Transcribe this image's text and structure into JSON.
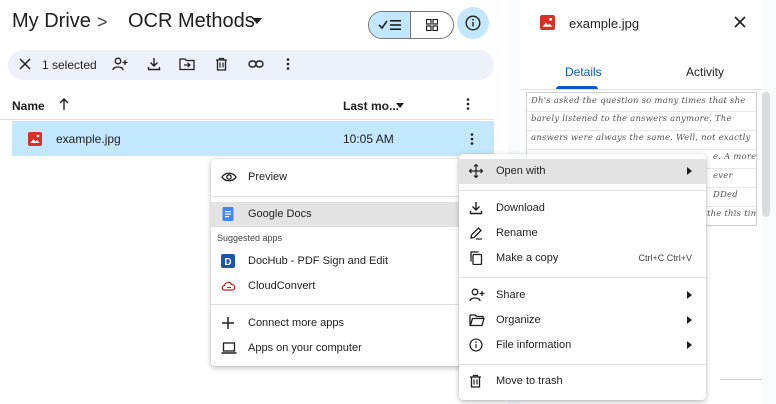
{
  "breadcrumb": {
    "root": "My Drive",
    "separator": ">",
    "folder": "OCR Methods"
  },
  "toolbar": {
    "selected_count": "1 selected"
  },
  "list": {
    "columns": {
      "name": "Name",
      "modified": "Last mo..."
    },
    "rows": [
      {
        "name": "example.jpg",
        "modified": "10:05 AM"
      }
    ]
  },
  "details": {
    "title": "example.jpg",
    "tabs": [
      "Details",
      "Activity"
    ],
    "preview_lines": [
      "Dh's asked the question so many times that she",
      "barely listened to the answers anymore. The",
      "answers were always the same. Well, not exactly",
      "e. A more",
      "ever",
      "DDed",
      "the this time"
    ]
  },
  "context_menu": {
    "preview": "Preview",
    "google_docs": "Google Docs",
    "suggested_header": "Suggested apps",
    "dochub": "DocHub - PDF Sign and Edit",
    "cloudconvert": "CloudConvert",
    "connect_more": "Connect more apps",
    "apps_on_computer": "Apps on your computer"
  },
  "main_menu": {
    "open_with": "Open with",
    "download": "Download",
    "rename": "Rename",
    "make_copy": "Make a copy",
    "make_copy_shortcut": "Ctrl+C Ctrl+V",
    "share": "Share",
    "organize": "Organize",
    "file_information": "File information",
    "move_to_trash": "Move to trash"
  },
  "colors": {
    "accent": "#0b57d0",
    "selected": "#c2e7ff",
    "image_red": "#d93025",
    "dochub_blue": "#1a57a8"
  }
}
